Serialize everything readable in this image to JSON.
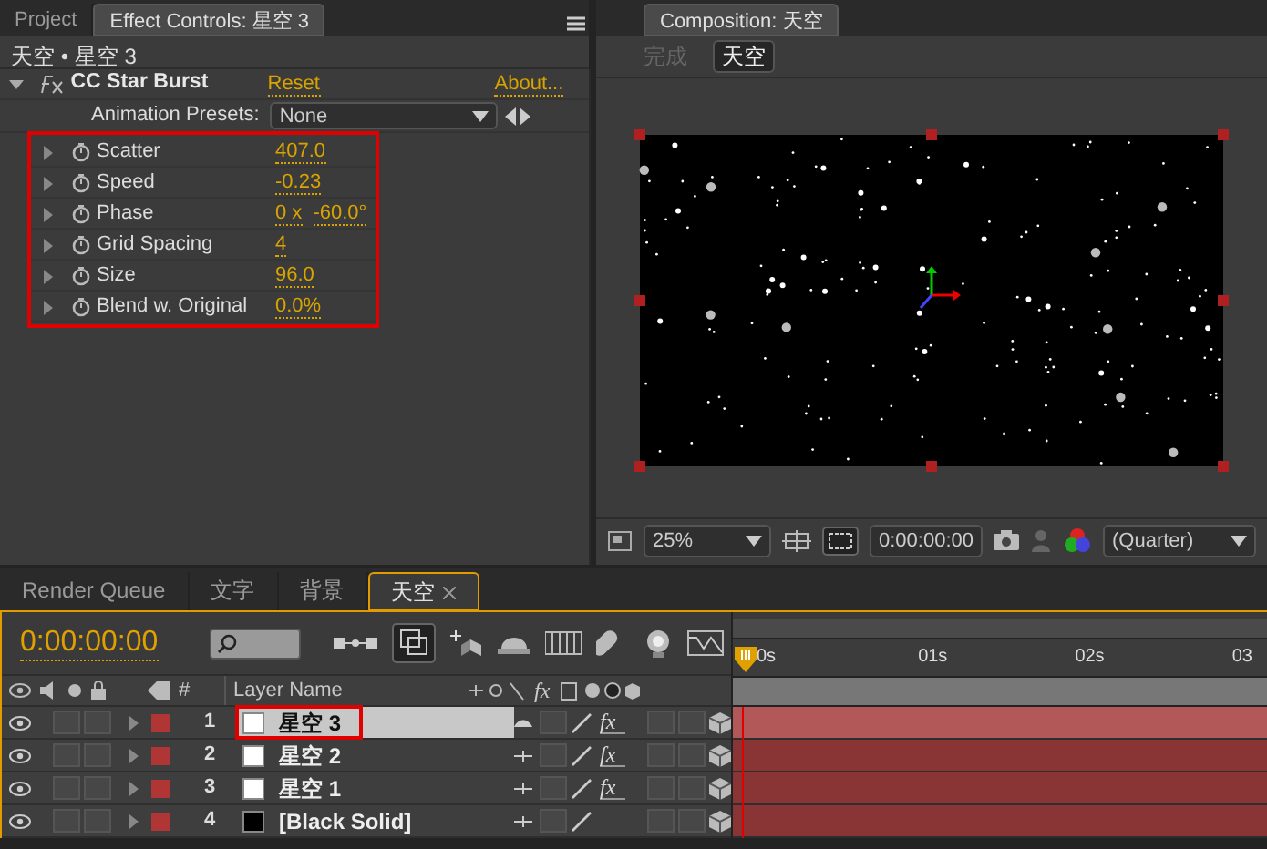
{
  "effect_panel": {
    "tabs": [
      {
        "label": "Project",
        "selected": false
      },
      {
        "label": "Effect Controls: 星空 3",
        "selected": true
      }
    ],
    "breadcrumb": "天空 • 星空 3",
    "effect": {
      "name": "CC Star Burst",
      "expanded": true,
      "reset": "Reset",
      "about": "About...",
      "presets_label": "Animation Presets:",
      "presets_value": "None"
    },
    "highlighted": true,
    "properties": [
      {
        "name": "Scatter",
        "expanded": false,
        "values": [
          "407.0"
        ]
      },
      {
        "name": "Speed",
        "expanded": false,
        "values": [
          "-0.23"
        ]
      },
      {
        "name": "Phase",
        "expanded": false,
        "values": [
          "0 x",
          "-60.0°"
        ]
      },
      {
        "name": "Grid Spacing",
        "expanded": false,
        "values": [
          "4"
        ]
      },
      {
        "name": "Size",
        "expanded": false,
        "values": [
          "96.0"
        ]
      },
      {
        "name": "Blend w. Original",
        "expanded": false,
        "values": [
          "0.0%"
        ]
      }
    ]
  },
  "composition_panel": {
    "tab": "Composition: 天空",
    "flowchart": [
      {
        "label": "完成",
        "selected": false
      },
      {
        "label": "天空",
        "selected": true
      }
    ],
    "zoom": "25%",
    "timecode": "0:00:00:00",
    "resolution": "(Quarter)"
  },
  "timeline": {
    "tabs": [
      {
        "label": "Render Queue",
        "selected": false
      },
      {
        "label": "文字",
        "selected": false
      },
      {
        "label": "背景",
        "selected": false
      },
      {
        "label": "天空",
        "selected": true
      }
    ],
    "timecode": "0:00:00:00",
    "columns": [
      "#",
      "Layer Name",
      "fx"
    ],
    "ruler": [
      "0s",
      "01s",
      "02s",
      "03"
    ],
    "layers": [
      {
        "number": "1",
        "name": "星空 3",
        "color": "#ffffff",
        "selected": true,
        "highlighted": true,
        "fx": "fx",
        "fx_enabled": true,
        "solo": false,
        "locked": false,
        "collapse": false,
        "motion_blur": false,
        "adjustment": false
      },
      {
        "number": "2",
        "name": "星空 2",
        "color": "#ffffff",
        "selected": false,
        "highlighted": false,
        "fx": "fx",
        "fx_enabled": true,
        "solo": false,
        "locked": false,
        "collapse": false,
        "motion_blur": false,
        "adjustment": false
      },
      {
        "number": "3",
        "name": "星空 1",
        "color": "#ffffff",
        "selected": false,
        "highlighted": false,
        "fx": "fx",
        "fx_enabled": true,
        "solo": false,
        "locked": false,
        "collapse": false,
        "motion_blur": false,
        "adjustment": false
      },
      {
        "number": "4",
        "name": "[Black Solid]",
        "color": "#000000",
        "selected": false,
        "highlighted": false,
        "solo": false,
        "locked": false,
        "collapse": false,
        "motion_blur": false,
        "adjustment": false
      }
    ]
  }
}
